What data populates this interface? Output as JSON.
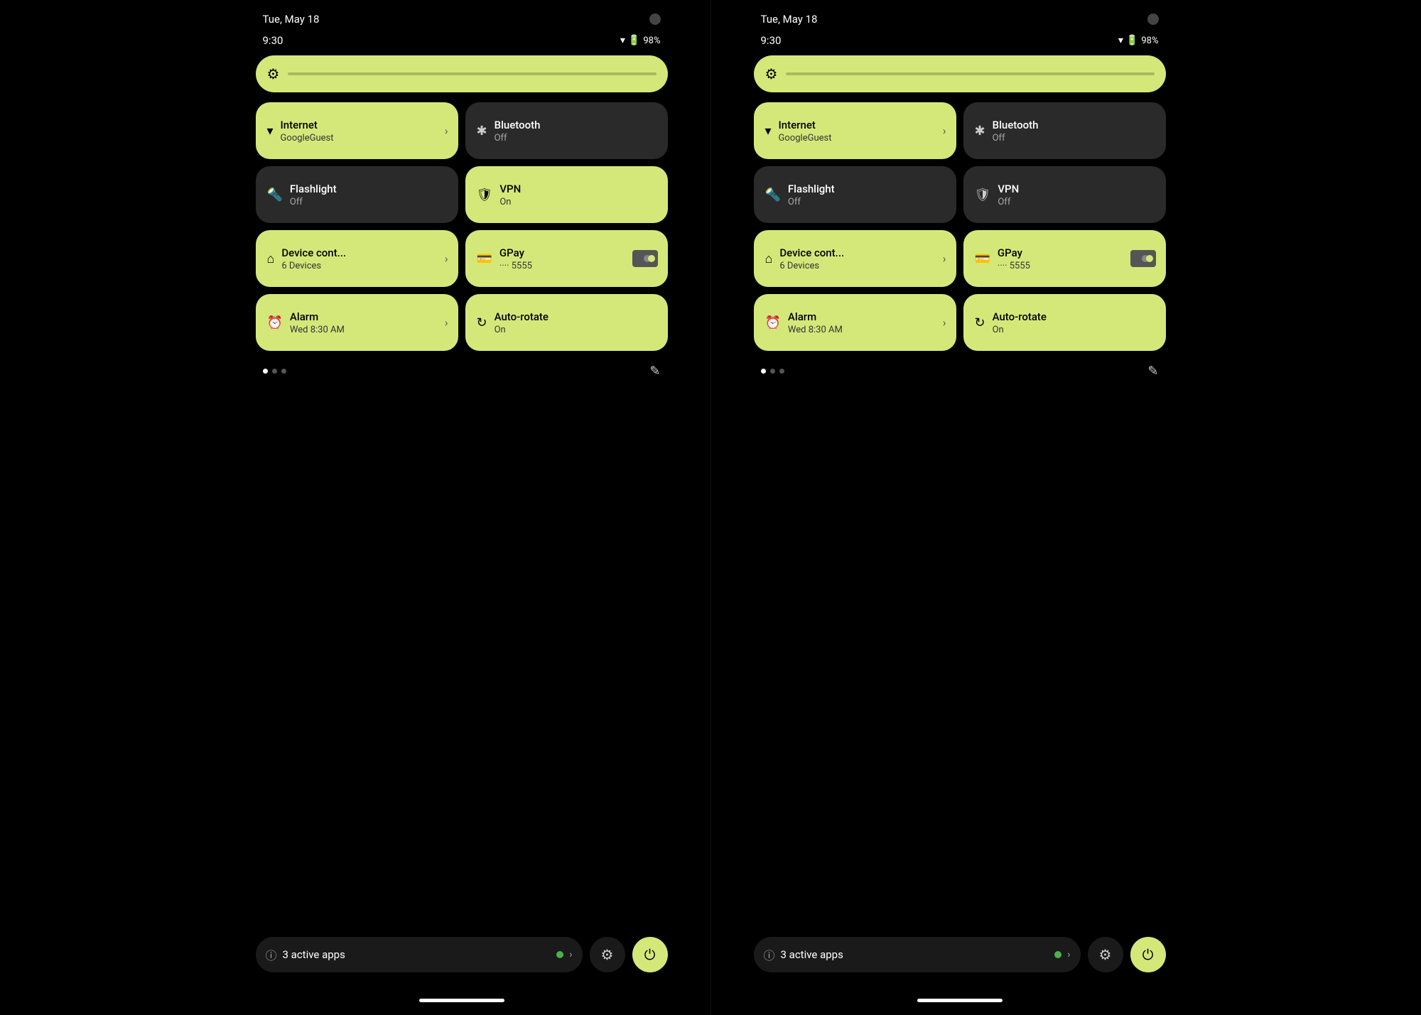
{
  "left": {
    "date": "Tue, May 18",
    "time": "9:30",
    "battery": "98%",
    "brightness_icon": "⚙",
    "tiles": [
      {
        "id": "internet",
        "icon": "wifi",
        "title": "Internet",
        "subtitle": "GoogleGuest",
        "state": "active",
        "has_chevron": true
      },
      {
        "id": "bluetooth",
        "icon": "bluetooth",
        "title": "Bluetooth",
        "subtitle": "Off",
        "state": "inactive",
        "has_chevron": false
      },
      {
        "id": "flashlight",
        "icon": "flashlight",
        "title": "Flashlight",
        "subtitle": "Off",
        "state": "inactive",
        "has_chevron": false
      },
      {
        "id": "vpn",
        "icon": "vpn",
        "title": "VPN",
        "subtitle": "On",
        "state": "active",
        "has_chevron": false
      },
      {
        "id": "device",
        "icon": "home",
        "title": "Device cont...",
        "subtitle": "6 Devices",
        "state": "active",
        "has_chevron": true
      },
      {
        "id": "gpay",
        "icon": "card",
        "title": "GPay",
        "subtitle": "···· 5555",
        "state": "active",
        "has_card": true
      },
      {
        "id": "alarm",
        "icon": "alarm",
        "title": "Alarm",
        "subtitle": "Wed 8:30 AM",
        "state": "active",
        "has_chevron": true
      },
      {
        "id": "autorotate",
        "icon": "rotate",
        "title": "Auto-rotate",
        "subtitle": "On",
        "state": "active",
        "has_chevron": false
      }
    ],
    "active_apps_label": "3 active apps",
    "dots": [
      "filled",
      "empty",
      "empty"
    ],
    "vpn_subtitle_left": "On"
  },
  "right": {
    "date": "Tue, May 18",
    "time": "9:30",
    "battery": "98%",
    "tiles": [
      {
        "id": "internet",
        "icon": "wifi",
        "title": "Internet",
        "subtitle": "GoogleGuest",
        "state": "active",
        "has_chevron": true
      },
      {
        "id": "bluetooth",
        "icon": "bluetooth",
        "title": "Bluetooth",
        "subtitle": "Off",
        "state": "inactive",
        "has_chevron": false
      },
      {
        "id": "flashlight",
        "icon": "flashlight",
        "title": "Flashlight",
        "subtitle": "Off",
        "state": "inactive",
        "has_chevron": false
      },
      {
        "id": "vpn",
        "icon": "vpn",
        "title": "VPN",
        "subtitle": "Off",
        "state": "inactive",
        "has_chevron": false
      },
      {
        "id": "device",
        "icon": "home",
        "title": "Device cont...",
        "subtitle": "6 Devices",
        "state": "active",
        "has_chevron": true
      },
      {
        "id": "gpay",
        "icon": "card",
        "title": "GPay",
        "subtitle": "···· 5555",
        "state": "active",
        "has_card": true
      },
      {
        "id": "alarm",
        "icon": "alarm",
        "title": "Alarm",
        "subtitle": "Wed 8:30 AM",
        "state": "active",
        "has_chevron": true
      },
      {
        "id": "autorotate",
        "icon": "rotate",
        "title": "Auto-rotate",
        "subtitle": "On",
        "state": "active",
        "has_chevron": false
      }
    ],
    "active_apps_label": "3 active apps",
    "dots": [
      "filled",
      "empty",
      "empty"
    ]
  }
}
